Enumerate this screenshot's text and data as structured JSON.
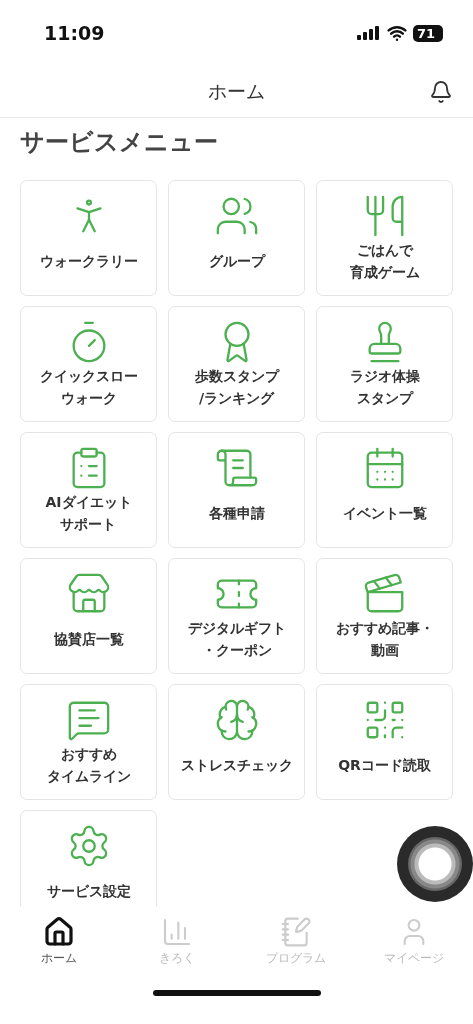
{
  "status_bar": {
    "time": "11:09",
    "battery": "71"
  },
  "header": {
    "title": "ホーム"
  },
  "section_title": "サービスメニュー",
  "menu": [
    {
      "lines": [
        "ウォークラリー"
      ]
    },
    {
      "lines": [
        "グループ"
      ]
    },
    {
      "lines": [
        "ごはんで",
        "育成ゲーム"
      ]
    },
    {
      "lines": [
        "クイックスロー",
        "ウォーク"
      ]
    },
    {
      "lines": [
        "歩数スタンプ",
        "/ランキング"
      ]
    },
    {
      "lines": [
        "ラジオ体操",
        "スタンプ"
      ]
    },
    {
      "lines": [
        "AIダイエット",
        "サポート"
      ]
    },
    {
      "lines": [
        "各種申請"
      ]
    },
    {
      "lines": [
        "イベント一覧"
      ]
    },
    {
      "lines": [
        "協賛店一覧"
      ]
    },
    {
      "lines": [
        "デジタルギフト",
        "・クーポン"
      ]
    },
    {
      "lines": [
        "おすすめ記事・",
        "動画"
      ]
    },
    {
      "lines": [
        "おすすめ",
        "タイムライン"
      ]
    },
    {
      "lines": [
        "ストレスチェック"
      ]
    },
    {
      "lines": [
        "QRコード読取"
      ]
    },
    {
      "lines": [
        "サービス設定"
      ]
    }
  ],
  "tab_bar": [
    {
      "label": "ホーム",
      "selected": true
    },
    {
      "label": "きろく",
      "selected": false
    },
    {
      "label": "プログラム",
      "selected": false
    },
    {
      "label": "マイページ",
      "selected": false
    }
  ]
}
